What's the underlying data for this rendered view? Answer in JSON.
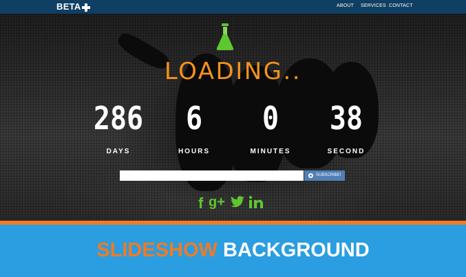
{
  "navbar": {
    "brand": "BETA",
    "links": [
      "ABOUT",
      "SERVICES",
      "CONTACT"
    ]
  },
  "hero": {
    "heading": "LOADING..",
    "countdown": [
      {
        "value": "286",
        "label": "DAYS"
      },
      {
        "value": "6",
        "label": "HOURS"
      },
      {
        "value": "0",
        "label": "MINUTES"
      },
      {
        "value": "38",
        "label": "SECOND"
      }
    ],
    "subscribe": {
      "input_value": "",
      "button_label": "SUBSCRIBE!"
    },
    "social": [
      "f",
      "g+"
    ]
  },
  "banner": {
    "part1": "SLIDESHOW",
    "part2": "BACKGROUND"
  },
  "colors": {
    "navbar": "#0f3f63",
    "accent_orange": "#f5921e",
    "social_green": "#5ec62e",
    "banner_blue": "#2a9ee0",
    "button_blue": "#4f7fb5"
  },
  "icons": [
    "plus-icon",
    "flask-icon",
    "gear-icon",
    "facebook-icon",
    "google-plus-icon",
    "twitter-icon",
    "linkedin-icon"
  ]
}
